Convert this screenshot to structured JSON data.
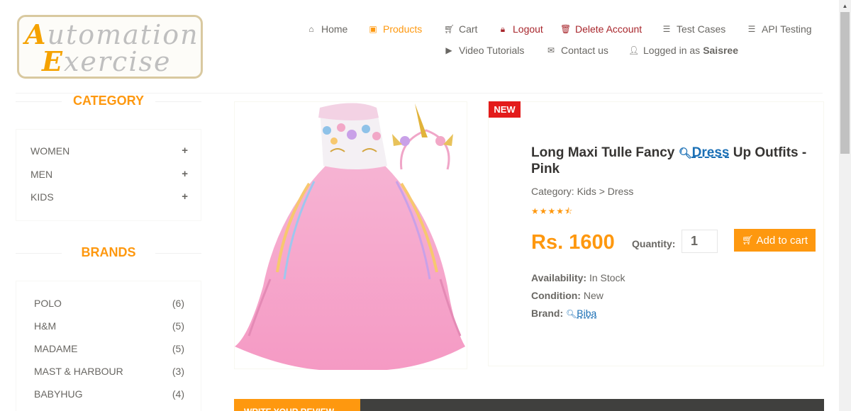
{
  "logo": {
    "line1_cap": "A",
    "line1_rest": "utomation",
    "line2_cap": "E",
    "line2_rest": "xercise"
  },
  "nav": {
    "home": "Home",
    "products": "Products",
    "cart": "Cart",
    "logout": "Logout",
    "delete_account": "Delete Account",
    "test_cases": "Test Cases",
    "api_testing": "API Testing",
    "video_tutorials": "Video Tutorials",
    "contact_us": "Contact us",
    "logged_in_as": "Logged in as",
    "username": "Saisree"
  },
  "sidebar": {
    "category_title": "CATEGORY",
    "categories": [
      {
        "label": "WOMEN",
        "toggle": "+"
      },
      {
        "label": "MEN",
        "toggle": "+"
      },
      {
        "label": "KIDS",
        "toggle": "+"
      }
    ],
    "brands_title": "BRANDS",
    "brands": [
      {
        "name": "POLO",
        "count": "(6)"
      },
      {
        "name": "H&M",
        "count": "(5)"
      },
      {
        "name": "MADAME",
        "count": "(5)"
      },
      {
        "name": "MAST & HARBOUR",
        "count": "(3)"
      },
      {
        "name": "BABYHUG",
        "count": "(4)"
      }
    ]
  },
  "product": {
    "badge": "NEW",
    "name_pre": "Long Maxi Tulle Fancy",
    "name_link": "Dress",
    "name_post": "Up Outfits - Pink",
    "category": "Category: Kids > Dress",
    "rating": 4.5,
    "stars": "★★★★⯪",
    "price": "Rs. 1600",
    "quantity_label": "Quantity:",
    "quantity_value": "1",
    "add_to_cart": "Add to cart",
    "availability_label": "Availability:",
    "availability_value": "In Stock",
    "condition_label": "Condition:",
    "condition_value": "New",
    "brand_label": "Brand:",
    "brand_value": "Biba"
  },
  "review": {
    "tab_label": "WRITE YOUR REVIEW"
  },
  "colors": {
    "accent": "#fe980f",
    "danger": "#a8262c",
    "badge": "#e31b1b",
    "link": "#1a6fb5",
    "dark_bar": "#40403e"
  },
  "icons": {
    "home": "home-icon",
    "products": "product-icon",
    "cart": "cart-icon",
    "logout": "lock-icon",
    "delete": "trash-icon",
    "test_cases": "list-icon",
    "api": "list-icon",
    "video": "youtube-icon",
    "contact": "envelope-icon",
    "user": "user-icon"
  }
}
